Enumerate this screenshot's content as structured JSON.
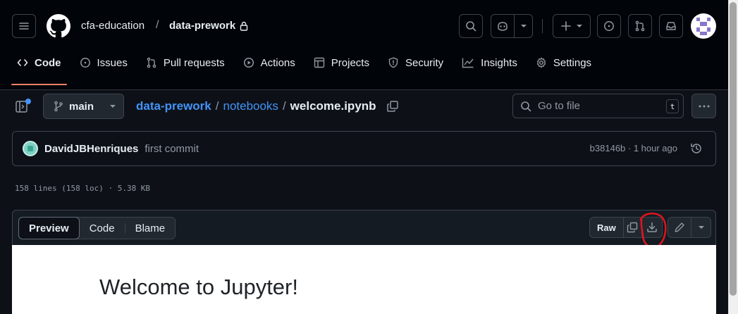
{
  "header": {
    "owner": "cfa-education",
    "separator": "/",
    "repo": "data-prework",
    "icons": [
      "menu-icon",
      "github-logo",
      "search-icon",
      "copilot-icon",
      "chevron-down-icon",
      "plus-icon",
      "issues-icon",
      "pull-request-icon",
      "inbox-icon",
      "avatar"
    ]
  },
  "tabs": [
    {
      "label": "Code",
      "icon": "code-icon",
      "active": true
    },
    {
      "label": "Issues",
      "icon": "issue-icon"
    },
    {
      "label": "Pull requests",
      "icon": "pull-request-icon"
    },
    {
      "label": "Actions",
      "icon": "play-icon"
    },
    {
      "label": "Projects",
      "icon": "table-icon"
    },
    {
      "label": "Security",
      "icon": "shield-icon"
    },
    {
      "label": "Insights",
      "icon": "graph-icon"
    },
    {
      "label": "Settings",
      "icon": "gear-icon"
    }
  ],
  "file_header": {
    "branch": "main",
    "breadcrumb": {
      "repo": "data-prework",
      "folder": "notebooks",
      "file": "welcome.ipynb",
      "sep": "/"
    },
    "goto_placeholder": "Go to file",
    "goto_shortcut": "t"
  },
  "commit": {
    "author": "DavidJBHenriques",
    "message": "first commit",
    "sha_time": "b38146b · 1 hour ago"
  },
  "file_meta": "158 lines (158 loc) · 5.38 KB",
  "viewer": {
    "modes": [
      "Preview",
      "Code",
      "Blame"
    ],
    "selected_mode": "Preview",
    "raw_label": "Raw"
  },
  "notebook": {
    "heading": "Welcome to Jupyter!"
  },
  "colors": {
    "accent_link": "#4493f8",
    "tab_underline": "#f78166",
    "annotation": "#e0141e"
  }
}
